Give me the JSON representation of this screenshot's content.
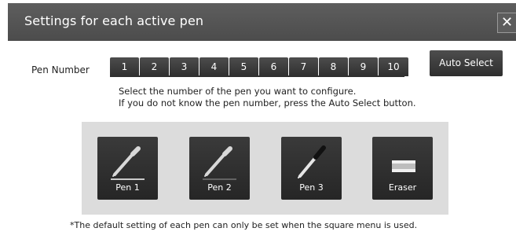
{
  "dialog": {
    "title": "Settings for each active pen",
    "close_symbol": "✕"
  },
  "pen_number": {
    "label": "Pen Number",
    "numbers": [
      "1",
      "2",
      "3",
      "4",
      "5",
      "6",
      "7",
      "8",
      "9",
      "10"
    ],
    "auto_select_label": "Auto Select"
  },
  "instructions": {
    "line1": "Select the number of the pen you want to configure.",
    "line2": "If you do not know the pen number, press the Auto Select button."
  },
  "pens": [
    {
      "label": "Pen 1",
      "icon": "pen-icon"
    },
    {
      "label": "Pen 2",
      "icon": "pen-icon"
    },
    {
      "label": "Pen 3",
      "icon": "marker-icon"
    },
    {
      "label": "Eraser",
      "icon": "eraser-icon"
    }
  ],
  "footnote": "*The default setting of each pen can only be set when the square menu is used.",
  "colors": {
    "titlebar": "#555555",
    "button_dark": "#2f2f2f",
    "panel_bg": "#dcdcdc"
  }
}
